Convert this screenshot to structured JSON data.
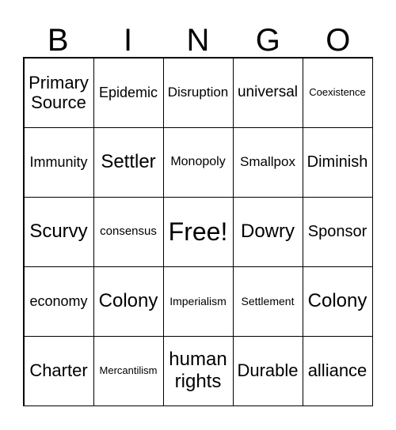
{
  "header": [
    "B",
    "I",
    "N",
    "G",
    "O"
  ],
  "cells": [
    [
      "Primary Source",
      "Epidemic",
      "Disruption",
      "universal",
      "Coexistence"
    ],
    [
      "Immunity",
      "Settler",
      "Monopoly",
      "Smallpox",
      "Diminish"
    ],
    [
      "Scurvy",
      "consensus",
      "Free!",
      "Dowry",
      "Sponsor"
    ],
    [
      "economy",
      "Colony",
      "Imperialism",
      "Settlement",
      "Colony"
    ],
    [
      "Charter",
      "Mercantilism",
      "human rights",
      "Durable",
      "alliance"
    ]
  ]
}
